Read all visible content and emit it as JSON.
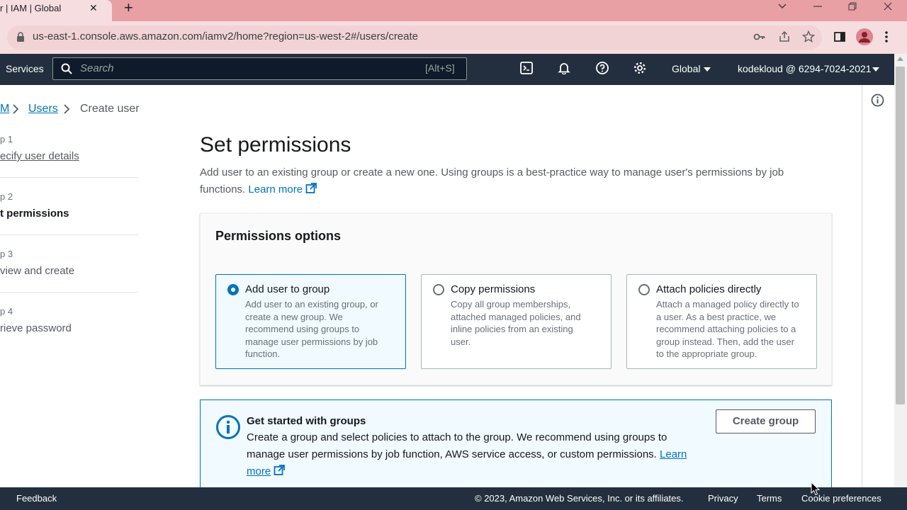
{
  "browser": {
    "tab_title": "r | IAM | Global",
    "url": "us-east-1.console.aws.amazon.com/iamv2/home?region=us-west-2#/users/create"
  },
  "nav": {
    "services": "Services",
    "search_placeholder": "Search",
    "search_shortcut": "[Alt+S]",
    "region": "Global",
    "account": "kodekloud @ 6294-7024-2021"
  },
  "breadcrumb": {
    "root": "M",
    "users": "Users",
    "current": "Create user"
  },
  "steps": [
    {
      "number": "p 1",
      "label": "ecify user details"
    },
    {
      "number": "p 2",
      "label": "t permissions"
    },
    {
      "number": "p 3",
      "label": "view and create"
    },
    {
      "number": "p 4",
      "label": "rieve password"
    }
  ],
  "main": {
    "title": "Set permissions",
    "description": "Add user to an existing group or create a new one. Using groups is a best-practice way to manage user's permissions by job functions.",
    "learn_more": "Learn more"
  },
  "permissions": {
    "title": "Permissions options",
    "options": [
      {
        "title": "Add user to group",
        "desc": "Add user to an existing group, or create a new group. We recommend using groups to manage user permissions by job function.",
        "selected": true
      },
      {
        "title": "Copy permissions",
        "desc": "Copy all group memberships, attached managed policies, and inline policies from an existing user.",
        "selected": false
      },
      {
        "title": "Attach policies directly",
        "desc": "Attach a managed policy directly to a user. As a best practice, we recommend attaching policies to a group instead. Then, add the user to the appropriate group.",
        "selected": false
      }
    ]
  },
  "alert": {
    "title": "Get started with groups",
    "body": "Create a group and select policies to attach to the group. We recommend using groups to manage user permissions by job function, AWS service access, or custom permissions.",
    "learn_more": "Learn more",
    "button": "Create group"
  },
  "footer": {
    "feedback": "Feedback",
    "copyright": "© 2023, Amazon Web Services, Inc. or its affiliates.",
    "privacy": "Privacy",
    "terms": "Terms",
    "cookies": "Cookie preferences"
  },
  "colors": {
    "aws_nav": "#232f3e",
    "link": "#0073bb",
    "tab_bar": "#e8a0a4"
  }
}
